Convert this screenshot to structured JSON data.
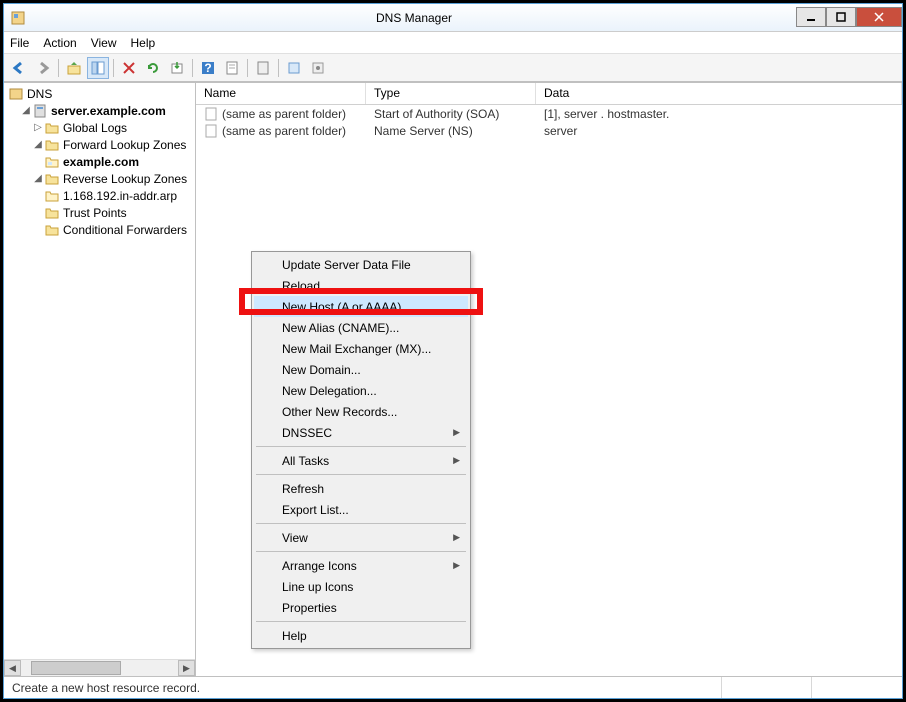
{
  "window": {
    "title": "DNS Manager"
  },
  "menu": {
    "file": "File",
    "action": "Action",
    "view": "View",
    "help": "Help"
  },
  "tree": {
    "root": "DNS",
    "server": "server.example.com",
    "global_logs": "Global Logs",
    "fwd_zones": "Forward Lookup Zones",
    "zone_example": "example.com",
    "rev_zones": "Reverse Lookup Zones",
    "rev_zone_1": "1.168.192.in-addr.arp",
    "trust_points": "Trust Points",
    "cond_fwd": "Conditional Forwarders"
  },
  "list": {
    "cols": {
      "name": "Name",
      "type": "Type",
      "data": "Data"
    },
    "rows": [
      {
        "name": "(same as parent folder)",
        "type": "Start of Authority (SOA)",
        "data": "[1],   server   . hostmaster."
      },
      {
        "name": "(same as parent folder)",
        "type": "Name Server (NS)",
        "data": "server"
      }
    ]
  },
  "ctx": {
    "update": "Update Server Data File",
    "reload": "Reload",
    "new_host": "New Host (A or AAAA)...",
    "new_alias": "New Alias (CNAME)...",
    "new_mx": "New Mail Exchanger (MX)...",
    "new_domain": "New Domain...",
    "new_delegation": "New Delegation...",
    "other_records": "Other New Records...",
    "dnssec": "DNSSEC",
    "all_tasks": "All Tasks",
    "refresh": "Refresh",
    "export": "Export List...",
    "view": "View",
    "arrange": "Arrange Icons",
    "lineup": "Line up Icons",
    "properties": "Properties",
    "help": "Help"
  },
  "status": {
    "text": "Create a new host resource record."
  },
  "colors": {
    "highlight_border": "#e11b1b",
    "menu_hover": "#cde8ff"
  }
}
